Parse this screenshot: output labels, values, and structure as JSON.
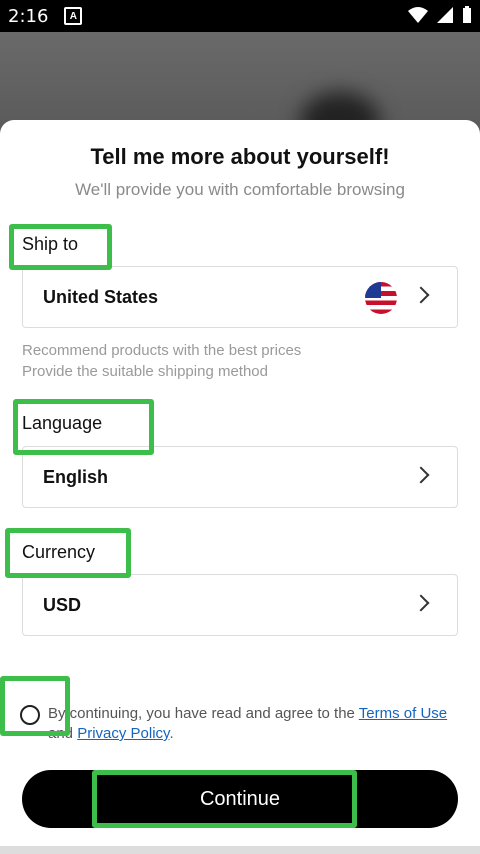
{
  "status_bar": {
    "time": "2:16",
    "app_icon": "A"
  },
  "sheet": {
    "title": "Tell me more about yourself!",
    "subtitle": "We'll provide you with comfortable browsing"
  },
  "ship_to": {
    "label": "Ship to",
    "value": "United States",
    "flag_icon": "us-flag-icon",
    "hints": [
      "Recommend products with the best prices",
      "Provide the suitable shipping method"
    ]
  },
  "language": {
    "label": "Language",
    "value": "English"
  },
  "currency": {
    "label": "Currency",
    "value": "USD"
  },
  "agreement": {
    "prefix": "By continuing, you have read and agree to the ",
    "terms_link": "Terms of Use",
    "and": " and ",
    "privacy_link": "Privacy Policy",
    "suffix": "."
  },
  "continue_label": "Continue",
  "colors": {
    "highlight": "#3dbd4a",
    "link": "#1565c0",
    "button": "#000000"
  }
}
